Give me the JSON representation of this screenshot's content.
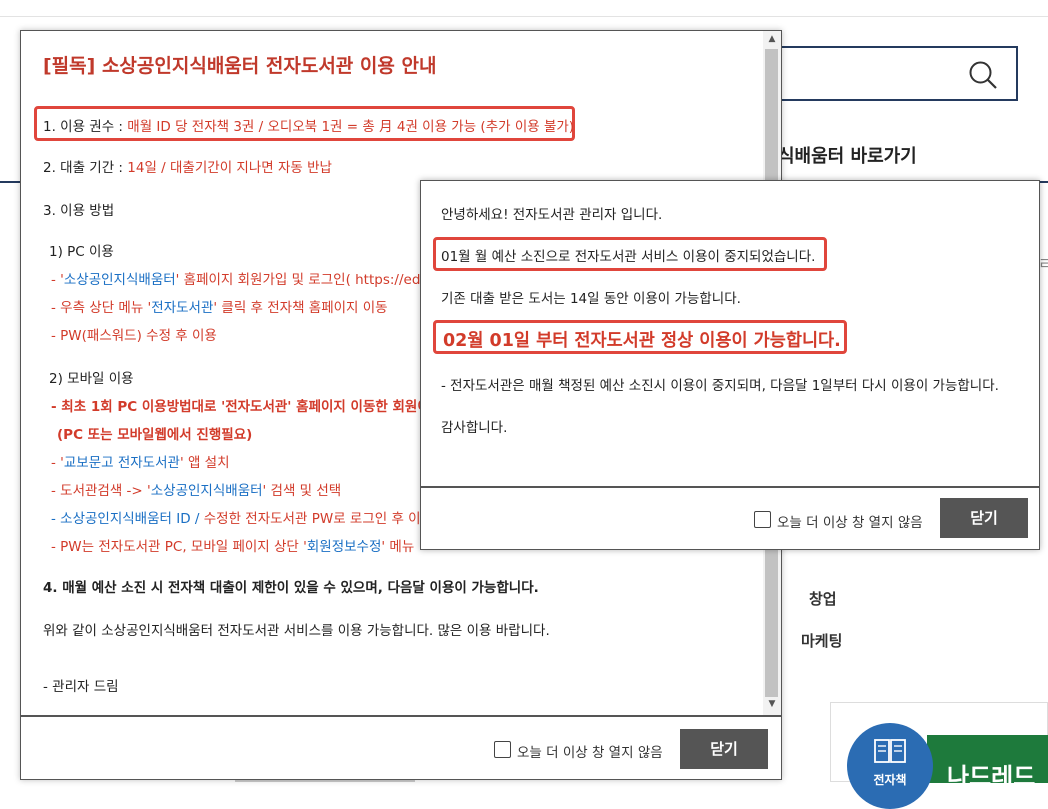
{
  "background": {
    "search_icon": "search-icon",
    "shortcut_text": "식배움터 바로가기",
    "side_text": "ㄹ",
    "menu_items": [
      "창업",
      "마케팅"
    ],
    "book_badge_label": "전자책",
    "book_cover_text": "나드레드"
  },
  "popup1": {
    "title": "[필독] 소상공인지식배움터 전자도서관 이용 안내",
    "item1_label": "1. 이용 권수 : ",
    "item1_value": "매월 ID 당 전자책 3권 / 오디오북 1권 = 총 月 4권 이용 가능 (추가 이용 불가)",
    "item2_label": "2. 대출 기간 : ",
    "item2_value": "14일 / 대출기간이 지나면 자동 반납",
    "item3_label": "3. 이용 방법",
    "pc_heading": "1) PC 이용",
    "pc_steps": [
      [
        "- '",
        "소상공인지식배움터",
        "' 홈페이지 회원가입 및 로그인( https://ed"
      ],
      [
        "- 우측 상단 메뉴 '",
        "전자도서관",
        "' 클릭 후 전자책 홈페이지 이동"
      ],
      [
        "- PW(패스워드) 수정 후 이용",
        "",
        ""
      ]
    ],
    "mobile_heading": "2) 모바일 이용",
    "mobile_step1": "- 최초 1회 PC 이용방법대로 '전자도서관' 홈페이지 이동한 회원이",
    "mobile_step1_note": "(PC 또는 모바일웹에서 진행필요)",
    "mobile_step2": [
      "- '",
      "교보문고 전자도서관",
      "' 앱 설치"
    ],
    "mobile_step3": [
      "- 도서관검색 -> '",
      "소상공인지식배움터",
      "' 검색 및 선택"
    ],
    "mobile_step4": [
      "- 소상공인지식배움터 ID / ",
      "수정한 전자도서관 PW",
      "로 로그인 후 이"
    ],
    "mobile_step5": [
      "- PW는 전자도서관 PC, 모바일 페이지 상단 '",
      "회원정보수정",
      "' 메뉴"
    ],
    "item4": "4. 매월 예산 소진 시 전자책 대출이 제한이 있을 수 있으며, 다음달 이용이 가능합니다.",
    "closing": "위와 같이 소상공인지식배움터 전자도서관 서비스를 이용 가능합니다. 많은 이용 바랍니다.",
    "signature": "- 관리자 드림",
    "dont_show_label": "오늘 더 이상 창 열지 않음",
    "close_label": "닫기",
    "accent_color": "#d23b2a",
    "link_color": "#1a6fc4"
  },
  "popup2": {
    "greeting": "안녕하세요! 전자도서관 관리자 입니다.",
    "notice": "01월 월 예산 소진으로 전자도서관 서비스 이용이 중지되었습니다.",
    "info": "기존 대출 받은 도서는 14일 동안 이용이 가능합니다.",
    "highlight": "02월 01일 부터 전자도서관 정상 이용이 가능합니다.",
    "detail": "- 전자도서관은 매월 책정된 예산 소진시 이용이 중지되며, 다음달 1일부터 다시 이용이 가능합니다.",
    "thanks": "감사합니다.",
    "dont_show_label": "오늘 더 이상 창 열지 않음",
    "close_label": "닫기",
    "highlight_border_color": "#e0463c"
  }
}
